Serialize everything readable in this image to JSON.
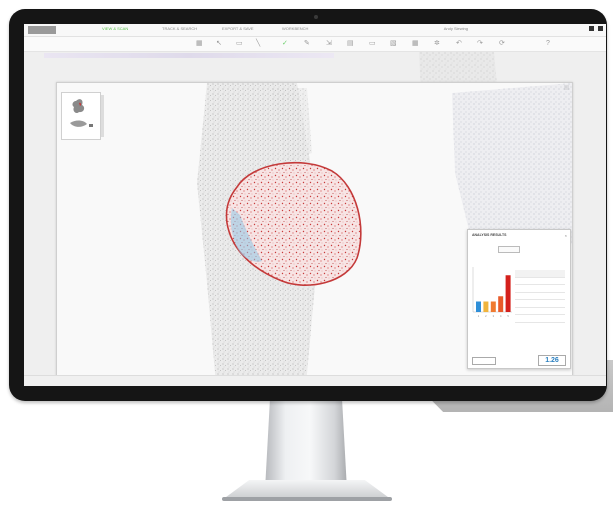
{
  "menubar": {
    "logo": "",
    "items": [
      {
        "label": "VIEW & SCAN",
        "active": true
      },
      {
        "label": "TRACK & SEARCH",
        "active": false
      },
      {
        "label": "EXPORT & SAVE",
        "active": false
      },
      {
        "label": "WORKBENCH",
        "active": false
      }
    ],
    "user": "Andy Siewing"
  },
  "toolbar": {
    "icons": [
      "grid-icon",
      "cursor-icon",
      "ruler-icon",
      "line-icon",
      "brush-icon",
      "pen-icon",
      "arrow-icon",
      "text-icon",
      "chat-icon",
      "layers-icon",
      "grid-icon",
      "settings-icon",
      "undo-icon",
      "redo-icon",
      "refresh-icon",
      "help-icon"
    ]
  },
  "viewer": {
    "title": "",
    "zoom_label": ""
  },
  "analysis_panel": {
    "title": "ANALYSIS RESULTS",
    "subtitle": "",
    "select_label": "",
    "table_header": [
      "",
      ""
    ],
    "rows": [],
    "footer_label": "",
    "score": "1.26"
  },
  "chart_data": {
    "type": "bar",
    "categories": [
      "1",
      "2",
      "3",
      "4",
      "5"
    ],
    "series": [
      {
        "values": [
          2,
          2,
          2,
          3,
          7
        ]
      }
    ],
    "colors": [
      "#2f8fd8",
      "#f0b43c",
      "#f07a30",
      "#e85a2a",
      "#d4201c"
    ],
    "title": "",
    "xlabel": "",
    "ylabel": ""
  },
  "colors": {
    "roi_outline": "#c43a3a",
    "roi_fill": "#f6dede",
    "accent_green": "#5ac24b",
    "score_blue": "#2a7fbf"
  }
}
